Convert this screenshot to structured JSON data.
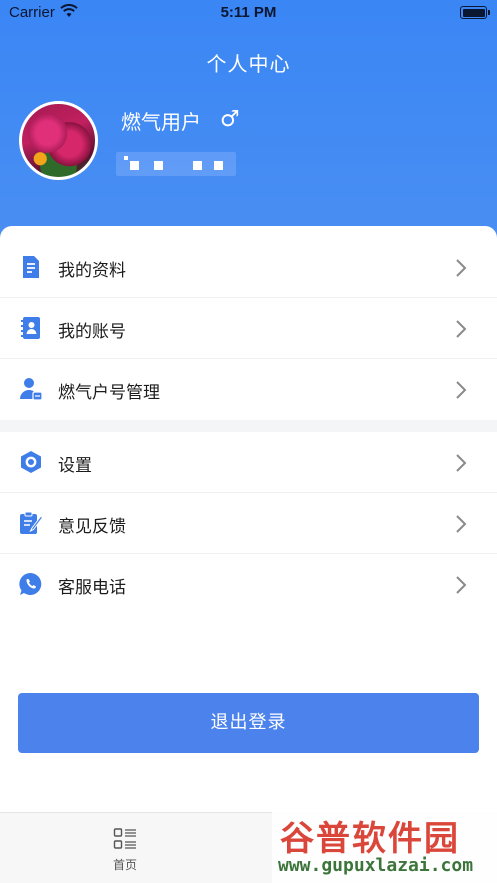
{
  "status_bar": {
    "carrier": "Carrier",
    "time": "5:11 PM"
  },
  "header": {
    "title": "个人中心",
    "username": "燃气用户",
    "gender_symbol": "♂",
    "background_color": "#3a86f5"
  },
  "menu_group_1": [
    {
      "label": "我的资料",
      "icon": "document-icon"
    },
    {
      "label": "我的账号",
      "icon": "contact-book-icon"
    },
    {
      "label": "燃气户号管理",
      "icon": "user-card-icon"
    }
  ],
  "menu_group_2": [
    {
      "label": "设置",
      "icon": "settings-hexagon-icon"
    },
    {
      "label": "意见反馈",
      "icon": "feedback-edit-icon"
    },
    {
      "label": "客服电话",
      "icon": "phone-bubble-icon"
    }
  ],
  "logout": {
    "label": "退出登录",
    "color": "#4c82ec"
  },
  "tabbar": {
    "home_label": "首页"
  },
  "watermark": {
    "title": "谷普软件园",
    "url": "www.gupuxlazai.com"
  },
  "accent_color": "#3f7ee8"
}
